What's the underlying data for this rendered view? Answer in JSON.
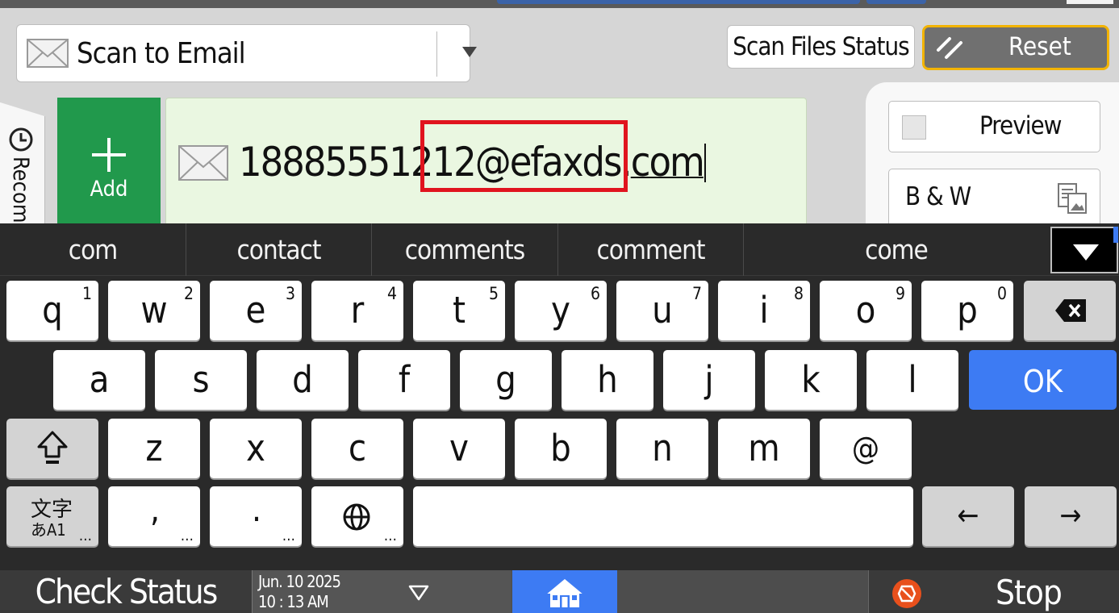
{
  "function_select": {
    "label": "Scan to Email"
  },
  "header_buttons": {
    "scan_files_status": "Scan Files Status",
    "reset": "Reset"
  },
  "side_tab": {
    "label": "Recomm"
  },
  "add_button": {
    "label": "Add"
  },
  "destination": {
    "prefix": "18885551212",
    "domain": "@efaxds.",
    "tld": "com"
  },
  "right_panel": {
    "preview": "Preview",
    "color_mode": "B & W"
  },
  "suggestions": [
    "com",
    "contact",
    "comments",
    "comment",
    "come"
  ],
  "keyboard": {
    "row1": [
      {
        "ch": "q",
        "num": "1"
      },
      {
        "ch": "w",
        "num": "2"
      },
      {
        "ch": "e",
        "num": "3"
      },
      {
        "ch": "r",
        "num": "4"
      },
      {
        "ch": "t",
        "num": "5"
      },
      {
        "ch": "y",
        "num": "6"
      },
      {
        "ch": "u",
        "num": "7"
      },
      {
        "ch": "i",
        "num": "8"
      },
      {
        "ch": "o",
        "num": "9"
      },
      {
        "ch": "p",
        "num": "0"
      }
    ],
    "row2": [
      "a",
      "s",
      "d",
      "f",
      "g",
      "h",
      "j",
      "k",
      "l"
    ],
    "ok": "OK",
    "row3": [
      "z",
      "x",
      "c",
      "v",
      "b",
      "n",
      "m",
      "@"
    ],
    "mode_key": {
      "line1": "文字",
      "line2": "あA1",
      "more": "…"
    },
    "comma": {
      "ch": ",",
      "more": "…"
    },
    "period": {
      "ch": ".",
      "more": "…"
    },
    "globe": {
      "more": "…"
    },
    "left_arrow": "←",
    "right_arrow": "→"
  },
  "status_bar": {
    "check_status": "Check Status",
    "date": "Jun. 10 2025",
    "time": "10 : 13 AM",
    "stop": "Stop"
  },
  "colors": {
    "add_green": "#21994c",
    "dest_bg": "#eaf7e1",
    "highlight_red": "#e0141e",
    "ok_blue": "#3d7bf3",
    "reset_border": "#f2b300"
  },
  "icons": {
    "function": "envelope-icon",
    "history": "clock-icon",
    "backspace": "backspace-icon",
    "shift": "shift-icon",
    "language": "globe-icon",
    "home": "home-icon",
    "stop": "stop-icon",
    "color_mode": "color-mode-icon"
  }
}
